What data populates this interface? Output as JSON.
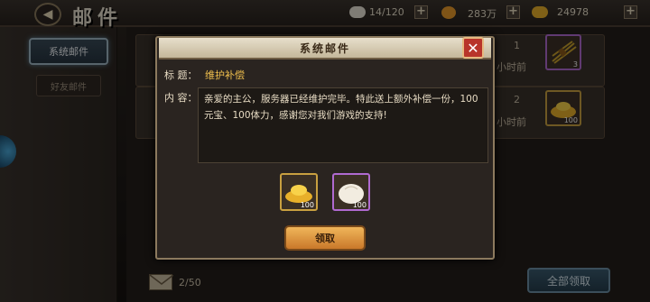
{
  "header": {
    "title": "邮件",
    "stamina": "14/120",
    "coins": "283万",
    "ingots": "24978"
  },
  "tabs": {
    "system": "系统邮件",
    "friend": "好友邮件"
  },
  "mail_list": [
    {
      "num": "1",
      "time": "小时前",
      "item_count": "3"
    },
    {
      "num": "2",
      "time": "小时前",
      "item_count": "100"
    }
  ],
  "footer": {
    "mail_count": "2/50",
    "collect_all": "全部领取"
  },
  "dialog": {
    "title": "系统邮件",
    "subject_label": "标 题：",
    "subject": "维护补偿",
    "content_label": "内 容：",
    "content": "亲爱的主公，服务器已经维护完毕。特此送上额外补偿一份，100元宝、100体力，感谢您对我们游戏的支持!",
    "attachments": [
      {
        "name": "ingot",
        "count": "100"
      },
      {
        "name": "steamed-bun",
        "count": "100"
      }
    ],
    "claim": "领取"
  },
  "colors": {
    "accent_gold": "#f2c14e",
    "purple_frame": "#b06ad0",
    "gold_frame": "#c9a040"
  }
}
